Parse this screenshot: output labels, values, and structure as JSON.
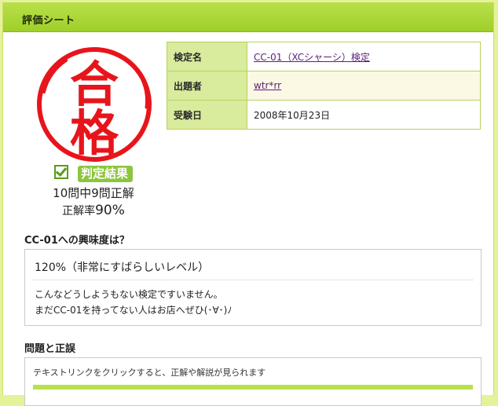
{
  "header": {
    "title": "評価シート"
  },
  "stamp": {
    "top_char": "合",
    "bottom_char": "格",
    "color": "#e8141b"
  },
  "result": {
    "label": "判定結果",
    "score": "10問中9問正解",
    "rate_prefix": "正解率",
    "rate_value": "90%"
  },
  "info": {
    "rows": [
      {
        "label": "検定名",
        "value": "CC-01（XCシャーシ）検定"
      },
      {
        "label": "出題者",
        "value": "wtr*rr"
      },
      {
        "label": "受験日",
        "value": "2008年10月23日"
      }
    ]
  },
  "interest": {
    "title": "CC-01への興味度は？",
    "level": "120%（非常にすばらしいレベル）",
    "comment_lines": [
      "こんなどうしようもない検定ですいません。",
      "まだCC-01を持ってない人はお店へぜひ(･∀･)ﾉ"
    ]
  },
  "qa": {
    "title": "問題と正誤",
    "hint": "テキストリンクをクリックすると、正解や解説が見られます"
  },
  "colors": {
    "header_green": "#9fcf2a",
    "label_cell": "#d9eb9c",
    "badge_green": "#8cc63f",
    "link": "#5a1f7a",
    "page_bg": "#e6f29a"
  }
}
